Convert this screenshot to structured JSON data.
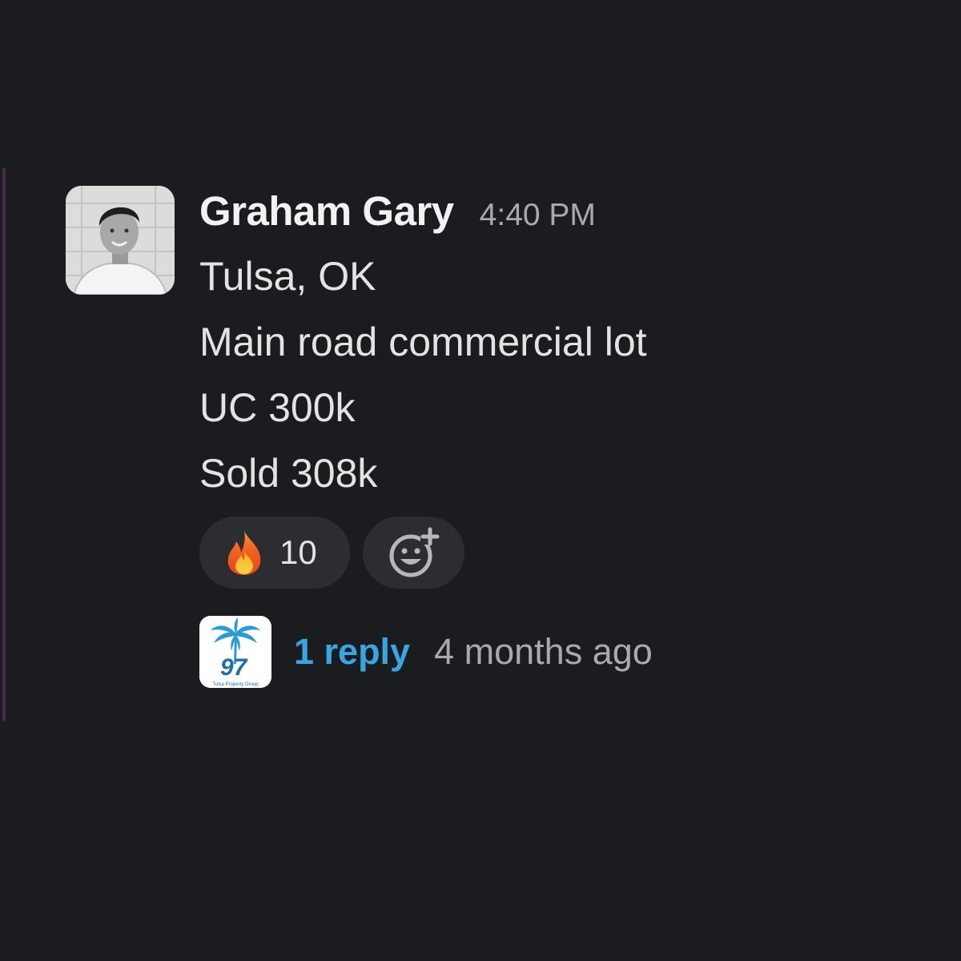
{
  "message": {
    "author": "Graham Gary",
    "timestamp": "4:40 PM",
    "lines": [
      "Tulsa, OK",
      "Main road commercial lot",
      "UC 300k",
      "Sold 308k"
    ]
  },
  "reactions": [
    {
      "emoji": "fire-icon",
      "count": "10"
    }
  ],
  "add_reaction_icon": "add-reaction-icon",
  "thread": {
    "reply_label": "1 reply",
    "time": "4 months ago",
    "avatar_logo_text": "97",
    "avatar_logo_subtext": "Tulsa Property Group"
  },
  "colors": {
    "background": "#1b1c20",
    "accent_bar": "#4a2a4c",
    "link": "#36a7e0",
    "pill": "#2c2d31"
  }
}
